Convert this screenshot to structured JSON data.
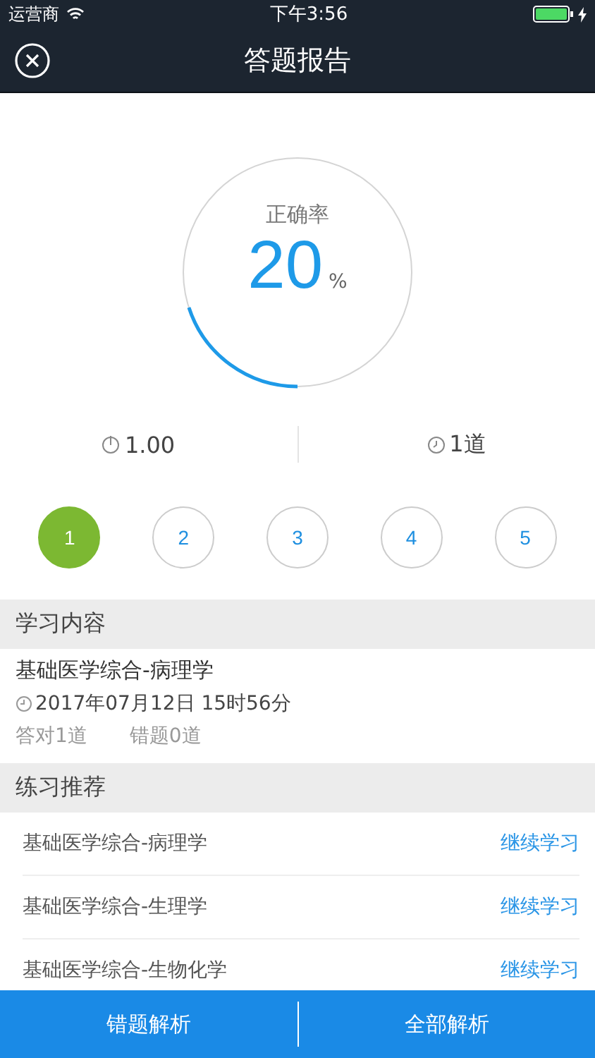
{
  "status_bar": {
    "carrier": "运营商",
    "time": "下午3:56"
  },
  "nav": {
    "title": "答题报告"
  },
  "score": {
    "label": "正确率",
    "value": "20",
    "unit": "%"
  },
  "stats": [
    {
      "kind": "timer",
      "text": "1.00"
    },
    {
      "kind": "clock",
      "text": "1道"
    }
  ],
  "questions": [
    {
      "label": "1",
      "selected": true
    },
    {
      "label": "2",
      "selected": false
    },
    {
      "label": "3",
      "selected": false
    },
    {
      "label": "4",
      "selected": false
    },
    {
      "label": "5",
      "selected": false
    }
  ],
  "study": {
    "heading": "学习内容",
    "title": "基础医学综合-病理学",
    "date": "2017年07月12日 15时56分",
    "correct": "答对1道",
    "wrong": "错题0道"
  },
  "recommend": {
    "heading": "练习推荐",
    "items": [
      {
        "name": "基础医学综合-病理学",
        "action": "继续学习"
      },
      {
        "name": "基础医学综合-生理学",
        "action": "继续学习"
      },
      {
        "name": "基础医学综合-生物化学",
        "action": "继续学习"
      }
    ]
  },
  "bottom_buttons": [
    "错题解析",
    "全部解析"
  ]
}
